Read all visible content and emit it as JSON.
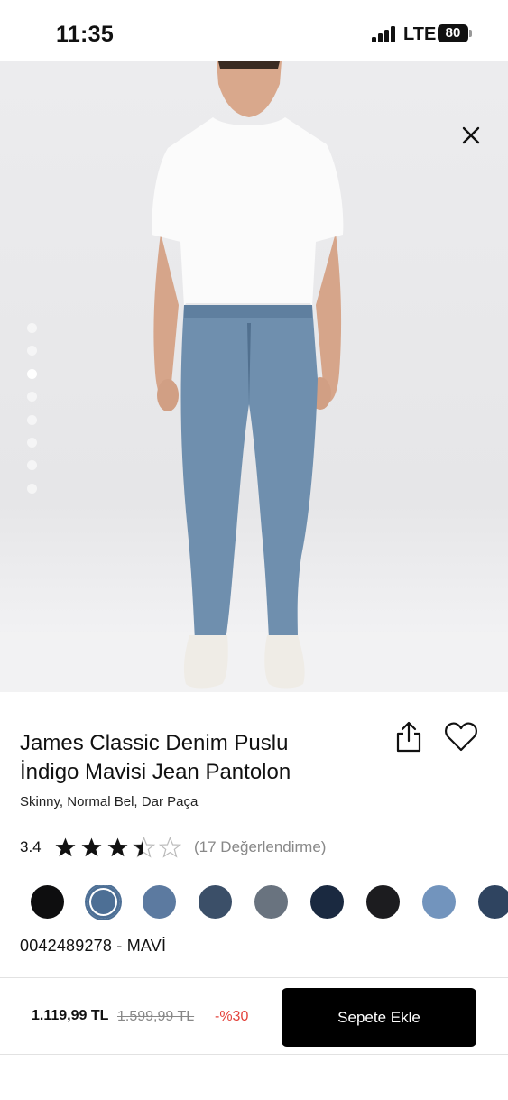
{
  "status_bar": {
    "time": "11:35",
    "network": "LTE",
    "battery": "80"
  },
  "gallery": {
    "dot_count": 8,
    "active_index": 2,
    "icon_close": "close-icon"
  },
  "product": {
    "title_line1": "James Classic Denim Puslu",
    "title_line2": "İndigo Mavisi Jean Pantolon",
    "subtitle": "Skinny, Normal Bel, Dar Paça",
    "rating": "3.4",
    "rating_value": 3.4,
    "rating_max": 5,
    "review_count": "(17 Değerlendirme)",
    "sku": "0042489278 - MAVİ",
    "share_icon": "share-icon",
    "favorite_icon": "heart-icon"
  },
  "swatches": [
    {
      "color": "#0e0e0f"
    },
    {
      "color": "#4d6f95",
      "selected": true
    },
    {
      "color": "#5c7aa0"
    },
    {
      "color": "#3b4f68"
    },
    {
      "color": "#69737f"
    },
    {
      "color": "#1a2940"
    },
    {
      "color": "#1c1c1f"
    },
    {
      "color": "#7294bd"
    },
    {
      "color": "#2f4460"
    }
  ],
  "purchase": {
    "price": "1.119,99 TL",
    "old_price": "1.599,99 TL",
    "discount": "-%30",
    "add_to_cart": "Sepete Ekle"
  },
  "colors": {
    "accent": "#000000",
    "discount": "#e3413a"
  }
}
